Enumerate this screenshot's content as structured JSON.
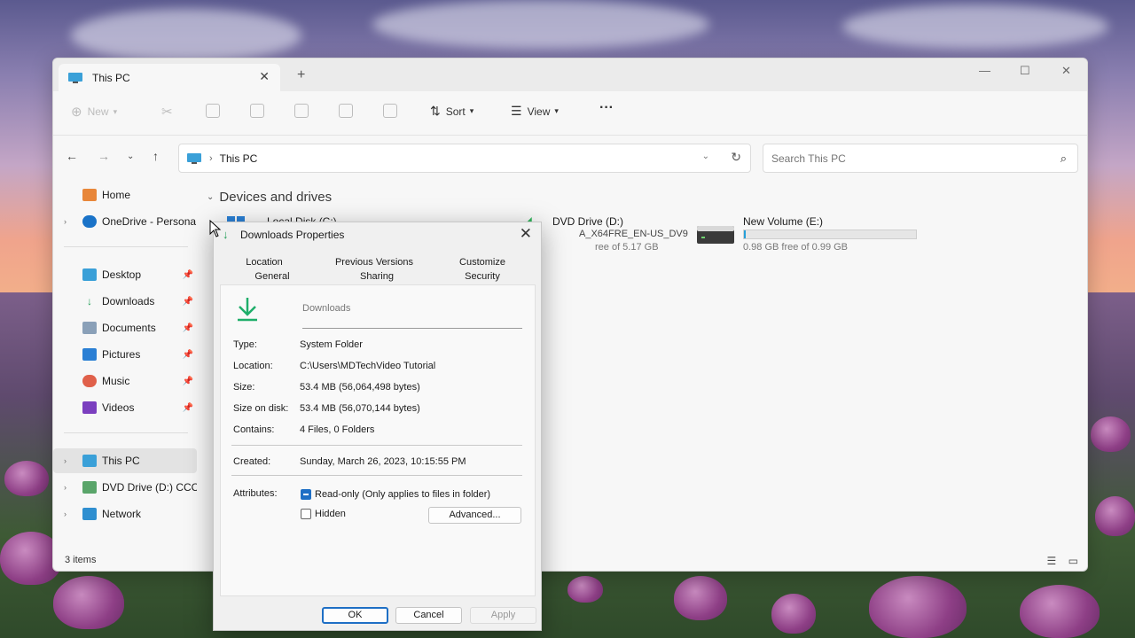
{
  "explorer": {
    "tab_title": "This PC",
    "toolbar": {
      "new_label": "New",
      "sort_label": "Sort",
      "view_label": "View",
      "more_label": "···"
    },
    "address": {
      "path": "This PC"
    },
    "search": {
      "placeholder": "Search This PC"
    },
    "sidebar": {
      "home": "Home",
      "onedrive": "OneDrive - Persona",
      "desktop": "Desktop",
      "downloads": "Downloads",
      "documents": "Documents",
      "pictures": "Pictures",
      "music": "Music",
      "videos": "Videos",
      "thispc": "This PC",
      "dvd": "DVD Drive (D:) CCC",
      "network": "Network"
    },
    "section_title": "Devices and drives",
    "drives": {
      "c": {
        "name": "Local Disk (C:)"
      },
      "d": {
        "name": "DVD Drive (D:)",
        "sub": "A_X64FRE_EN-US_DV9",
        "free": "ree of 5.17 GB"
      },
      "e": {
        "name": "New Volume (E:)",
        "free": "0.98 GB free of 0.99 GB",
        "used_fraction": 0.01
      }
    },
    "status": "3 items"
  },
  "dialog": {
    "title": "Downloads Properties",
    "tabs_row1": [
      "Location",
      "Previous Versions",
      "Customize"
    ],
    "tabs_row2": [
      "General",
      "Sharing",
      "Security"
    ],
    "folder_name": "Downloads",
    "props": {
      "type_label": "Type:",
      "type_value": "System Folder",
      "location_label": "Location:",
      "location_value": "C:\\Users\\MDTechVideo Tutorial",
      "size_label": "Size:",
      "size_value": "53.4 MB (56,064,498 bytes)",
      "sizeondisk_label": "Size on disk:",
      "sizeondisk_value": "53.4 MB (56,070,144 bytes)",
      "contains_label": "Contains:",
      "contains_value": "4 Files, 0 Folders",
      "created_label": "Created:",
      "created_value": "Sunday, March 26, 2023, 10:15:55 PM",
      "attributes_label": "Attributes:",
      "readonly_label": "Read-only (Only applies to files in folder)",
      "hidden_label": "Hidden",
      "advanced_label": "Advanced..."
    },
    "buttons": {
      "ok": "OK",
      "cancel": "Cancel",
      "apply": "Apply"
    }
  }
}
